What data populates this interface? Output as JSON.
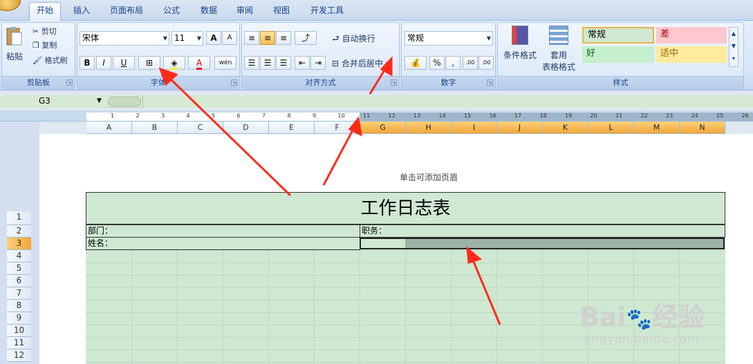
{
  "tabs": [
    "开始",
    "插入",
    "页面布局",
    "公式",
    "数据",
    "审阅",
    "视图",
    "开发工具"
  ],
  "ribbon": {
    "clipboard": {
      "paste": "粘贴",
      "cut": "剪切",
      "copy": "复制",
      "format_painter": "格式刷",
      "label": "剪贴板"
    },
    "font": {
      "name": "宋体",
      "size": "11",
      "bold": "B",
      "italic": "I",
      "underline": "U",
      "label": "字体",
      "phonetic": "wén",
      "grow": "A",
      "shrink": "A"
    },
    "alignment": {
      "wrap": "自动换行",
      "merge": "合并后居中",
      "label": "对齐方式"
    },
    "number": {
      "format": "常规",
      "percent": "%",
      "comma": ",",
      "inc_decimal": ".00",
      "dec_decimal": ".00",
      "label": "数字"
    },
    "styles": {
      "cond_format": "条件格式",
      "table_format_1": "套用",
      "table_format_2": "表格格式",
      "normal": "常规",
      "bad": "差",
      "good": "好",
      "neutral": "适中",
      "label": "样式"
    }
  },
  "formula_bar": {
    "name_box": "G3",
    "fx": "fx",
    "content": ""
  },
  "ruler_numbers": [
    "1",
    "2",
    "3",
    "4",
    "5",
    "6",
    "7",
    "8",
    "9",
    "10",
    "11",
    "12",
    "13",
    "14",
    "15",
    "16",
    "17",
    "18",
    "19",
    "20",
    "21",
    "22",
    "23",
    "24",
    "25",
    "26"
  ],
  "columns": [
    "A",
    "B",
    "C",
    "D",
    "E",
    "F",
    "G",
    "H",
    "I",
    "J",
    "K",
    "L",
    "M",
    "N"
  ],
  "rows": [
    "1",
    "2",
    "3",
    "4",
    "5",
    "6",
    "7",
    "8",
    "9",
    "10",
    "11",
    "12"
  ],
  "page_header_hint": "单击可添加页眉",
  "sheet": {
    "title": "工作日志表",
    "dept_label": "部门：",
    "position_label": "职务：",
    "name_label": "姓名："
  },
  "watermark": {
    "brand": "Bai",
    "brand2": "经验",
    "url": "jingyan.baidu.com"
  },
  "colors": {
    "arrow": "#ff2a1a",
    "selection": "#f3a638",
    "sheet_fill": "#cfe8d2"
  }
}
